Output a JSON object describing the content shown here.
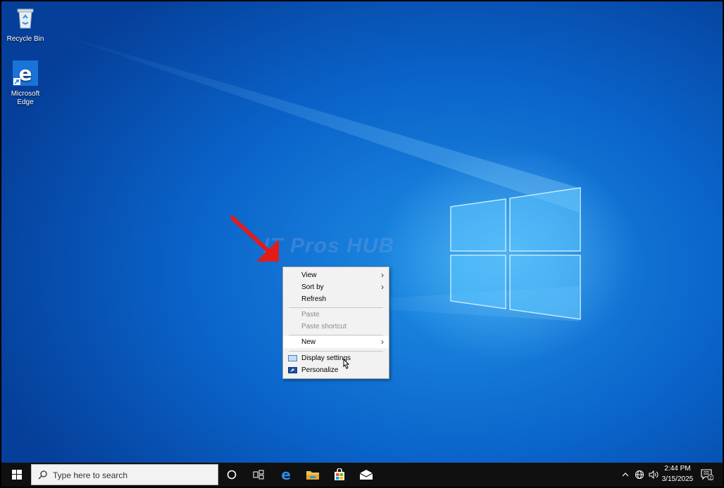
{
  "desktop": {
    "icons": [
      {
        "label": "Recycle Bin",
        "icon": "recycle-bin-icon"
      },
      {
        "label": "Microsoft\nEdge",
        "label_line1": "Microsoft",
        "label_line2": "Edge",
        "icon": "edge-icon"
      }
    ],
    "watermark": "IT Pros HUB"
  },
  "context_menu": {
    "items": [
      {
        "label": "View",
        "has_submenu": true
      },
      {
        "label": "Sort by",
        "has_submenu": true
      },
      {
        "label": "Refresh"
      },
      {
        "label": "Paste",
        "disabled": true
      },
      {
        "label": "Paste shortcut",
        "disabled": true
      },
      {
        "label": "New",
        "has_submenu": true,
        "highlighted": true
      },
      {
        "label": "Display settings",
        "icon": "display-icon"
      },
      {
        "label": "Personalize",
        "icon": "personalize-icon"
      }
    ]
  },
  "taskbar": {
    "search_placeholder": "Type here to search",
    "pinned": [
      "cortana-icon",
      "task-view-icon",
      "edge-icon",
      "file-explorer-icon",
      "store-icon",
      "mail-icon"
    ],
    "clock": {
      "time": "2:44 PM",
      "date": "3/15/2025"
    },
    "notification_count": "2"
  },
  "colors": {
    "desktop": "#0a63c9",
    "taskbar": "#101010",
    "annotation_arrow": "#e21b1b"
  }
}
